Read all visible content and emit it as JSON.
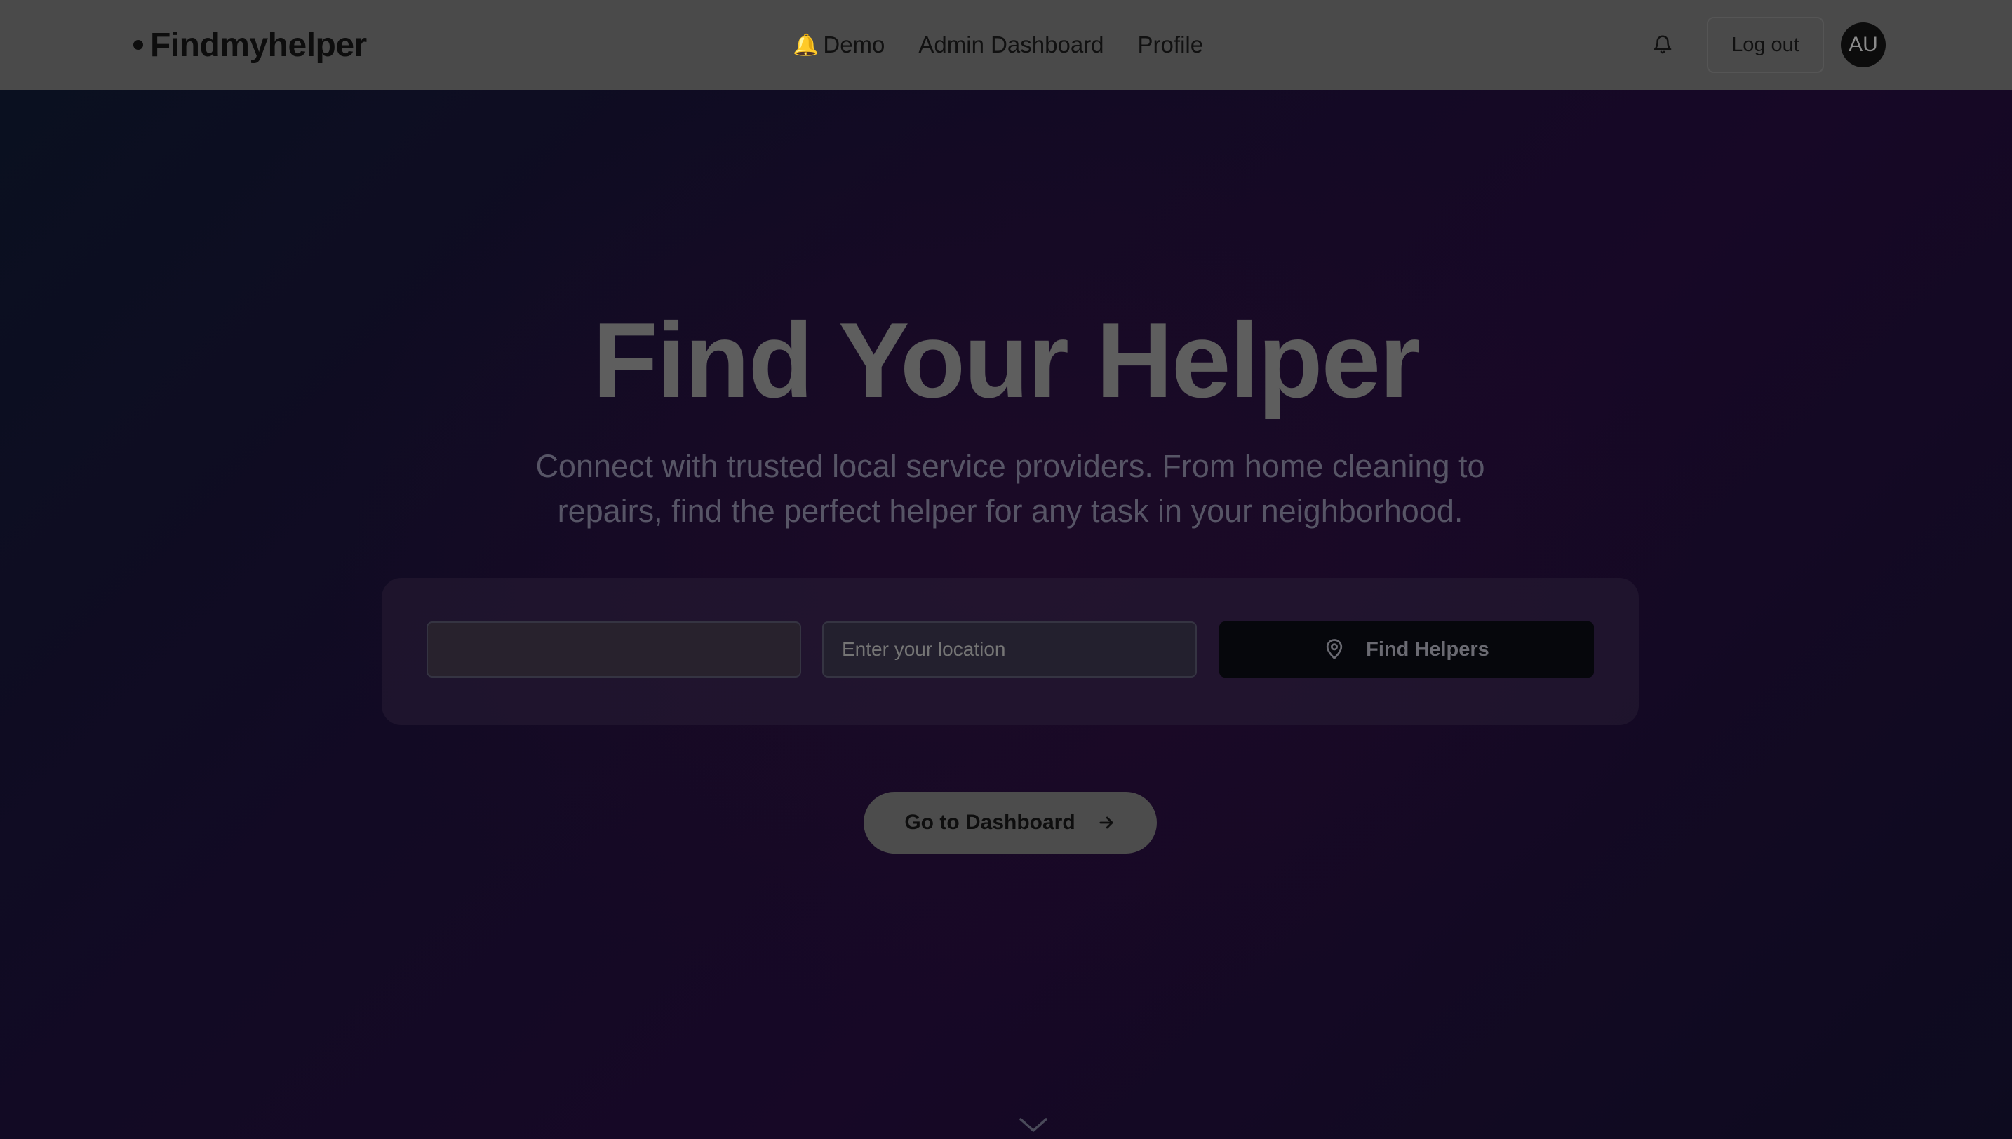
{
  "brand": {
    "name": "Findmyhelper"
  },
  "nav": {
    "demo": {
      "icon": "bell-emoji-icon",
      "label": "Demo"
    },
    "admin_dashboard": "Admin Dashboard",
    "profile": "Profile"
  },
  "header_actions": {
    "notifications_icon": "bell-icon",
    "logout_label": "Log out",
    "avatar_initials": "AU"
  },
  "hero": {
    "title": "Find Your Helper",
    "subtitle": "Connect with trusted local service providers. From home cleaning to repairs, find the perfect helper for any task in your neighborhood."
  },
  "search": {
    "service_placeholder": "",
    "location_placeholder": "Enter your location",
    "find_button_label": "Find Helpers",
    "find_button_icon": "map-pin-icon"
  },
  "cta": {
    "dashboard_label": "Go to Dashboard",
    "dashboard_icon": "arrow-right-icon"
  },
  "scroll_indicator": {
    "icon": "chevron-down-icon"
  }
}
